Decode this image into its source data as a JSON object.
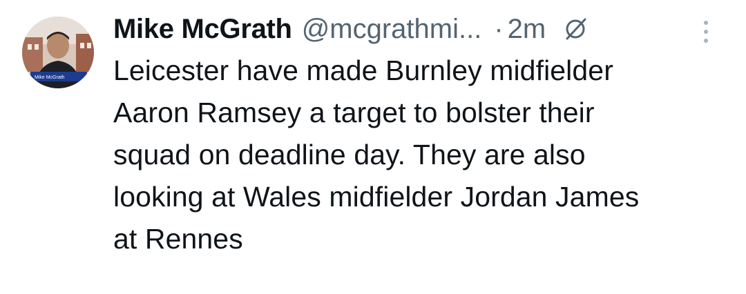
{
  "tweet": {
    "author": {
      "display_name": "Mike McGrath",
      "handle": "@mcgrathmi...",
      "avatar_caption": "Mike McGrath"
    },
    "dot": "·",
    "time": "2m",
    "text": "Leicester have made Burnley midfielder\nAaron Ramsey a target to bolster their\nsquad on deadline day. They are also\nlooking at Wales midfielder Jordan James\nat Rennes"
  },
  "icons": {
    "grok": "grok-slash-icon",
    "more": "more-options-icon"
  },
  "colors": {
    "text_primary": "#0f1419",
    "text_secondary": "#536471",
    "background": "#ffffff"
  }
}
